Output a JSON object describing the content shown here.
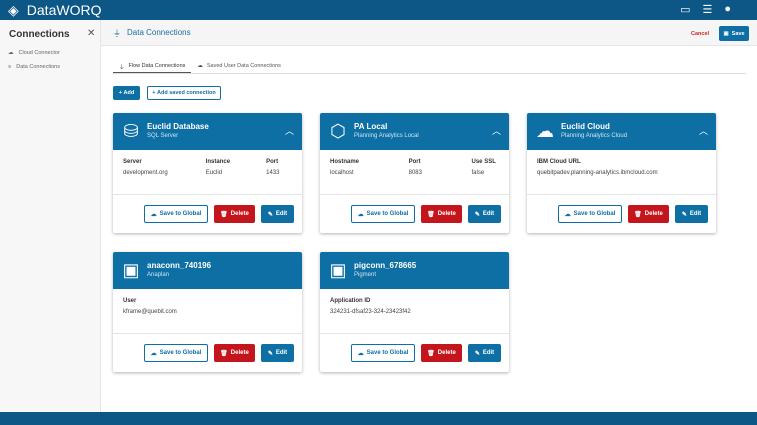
{
  "app": {
    "title": "DataWORQ"
  },
  "sidebar": {
    "title": "Connections",
    "items": [
      {
        "label": "Cloud Connector",
        "icon": "cloud-icon"
      },
      {
        "label": "Data Connections",
        "icon": "database-icon"
      }
    ]
  },
  "main": {
    "title": "Data Connections",
    "cancel": "Cancel",
    "save": "Save",
    "tabs": [
      {
        "label": "Flow Data Connections"
      },
      {
        "label": "Saved User Data Connections"
      }
    ],
    "add": "Add",
    "add_saved": "Add saved connection"
  },
  "actions": {
    "save_global": "Save to Global",
    "delete": "Delete",
    "edit": "Edit"
  },
  "cards": [
    {
      "name": "Euclid Database",
      "type": "SQL Server",
      "fields": [
        {
          "label": "Server",
          "value": "development.org"
        },
        {
          "label": "Instance",
          "value": "Euclid"
        },
        {
          "label": "Port",
          "value": "1433"
        }
      ]
    },
    {
      "name": "PA Local",
      "type": "Planning Analytics Local",
      "fields": [
        {
          "label": "Hostname",
          "value": "localhost"
        },
        {
          "label": "Port",
          "value": "8083"
        },
        {
          "label": "Use SSL",
          "value": "false"
        }
      ]
    },
    {
      "name": "Euclid Cloud",
      "type": "Planning Analytics Cloud",
      "fields": [
        {
          "label": "IBM Cloud URL",
          "value": "quebitpadev.planning-analytics.ibmcloud.com"
        }
      ]
    },
    {
      "name": "anaconn_740196",
      "type": "Anaplan",
      "fields": [
        {
          "label": "User",
          "value": "kframe@quebit.com"
        }
      ]
    },
    {
      "name": "pigconn_678665",
      "type": "Pigment",
      "fields": [
        {
          "label": "Application ID",
          "value": "324231-dfsaf23-324-23423f42"
        }
      ]
    }
  ]
}
